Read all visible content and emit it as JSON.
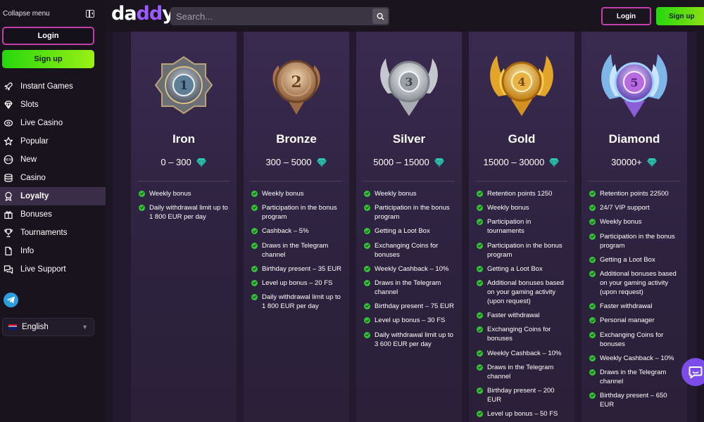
{
  "sidebar": {
    "collapse_label": "Collapse menu",
    "login_label": "Login",
    "signup_label": "Sign up",
    "items": [
      {
        "label": "Instant Games",
        "icon": "rocket-icon"
      },
      {
        "label": "Slots",
        "icon": "diamond-icon"
      },
      {
        "label": "Live Casino",
        "icon": "coin-icon"
      },
      {
        "label": "Popular",
        "icon": "star-icon"
      },
      {
        "label": "New",
        "icon": "new-badge-icon"
      },
      {
        "label": "Casino",
        "icon": "chip-stack-icon"
      },
      {
        "label": "Loyalty",
        "icon": "medal-icon",
        "active": true
      },
      {
        "label": "Bonuses",
        "icon": "gift-icon"
      },
      {
        "label": "Tournaments",
        "icon": "trophy-icon"
      },
      {
        "label": "Info",
        "icon": "document-icon"
      },
      {
        "label": "Live Support",
        "icon": "chat-icon"
      }
    ],
    "language": "English"
  },
  "header": {
    "logo_text": "daddy",
    "search_placeholder": "Search...",
    "login_label": "Login",
    "signup_label": "Sign up"
  },
  "colors": {
    "accent_green": "#35c23a",
    "accent_purple": "#9b5cff",
    "login_border": "#c23ea8"
  },
  "tiers": [
    {
      "name": "Iron",
      "range": "0 – 300",
      "badge_number": "1",
      "features": [
        "Weekly bonus",
        "Daily withdrawal limit up to 1 800 EUR per day"
      ]
    },
    {
      "name": "Bronze",
      "range": "300 – 5000",
      "badge_number": "2",
      "features": [
        "Weekly bonus",
        "Participation in the bonus program",
        "Cashback – 5%",
        "Draws in the Telegram channel",
        "Birthday present – 35 EUR",
        "Level up bonus – 20 FS",
        "Daily withdrawal limit up to 1 800 EUR per day"
      ]
    },
    {
      "name": "Silver",
      "range": "5000 – 15000",
      "badge_number": "3",
      "features": [
        "Weekly bonus",
        "Participation in the bonus program",
        "Getting a Loot Box",
        "Exchanging Coins for bonuses",
        "Weekly Cashback – 10%",
        "Draws in the Telegram channel",
        "Birthday present – 75 EUR",
        "Level up bonus – 30 FS",
        "Daily withdrawal limit up to 3 600 EUR per day"
      ]
    },
    {
      "name": "Gold",
      "range": "15000 – 30000",
      "badge_number": "4",
      "features": [
        "Retention points 1250",
        "Weekly bonus",
        "Participation in tournaments",
        "Participation in the bonus program",
        "Getting a Loot Box",
        "Additional bonuses based on your gaming activity (upon request)",
        "Faster withdrawal",
        "Exchanging Coins for bonuses",
        "Weekly Cashback – 10%",
        "Draws in the Telegram channel",
        "Birthday present – 200 EUR",
        "Level up bonus – 50 FS"
      ]
    },
    {
      "name": "Diamond",
      "range": "30000+",
      "badge_number": "5",
      "features": [
        "Retention points 22500",
        "24/7 VIP support",
        "Weekly bonus",
        "Participation in the bonus program",
        "Getting a Loot Box",
        "Additional bonuses based on your gaming activity (upon request)",
        "Faster withdrawal",
        "Personal manager",
        "Exchanging Coins for bonuses",
        "Weekly Cashback – 10%",
        "Draws in the Telegram channel",
        "Birthday present – 650 EUR"
      ]
    }
  ]
}
